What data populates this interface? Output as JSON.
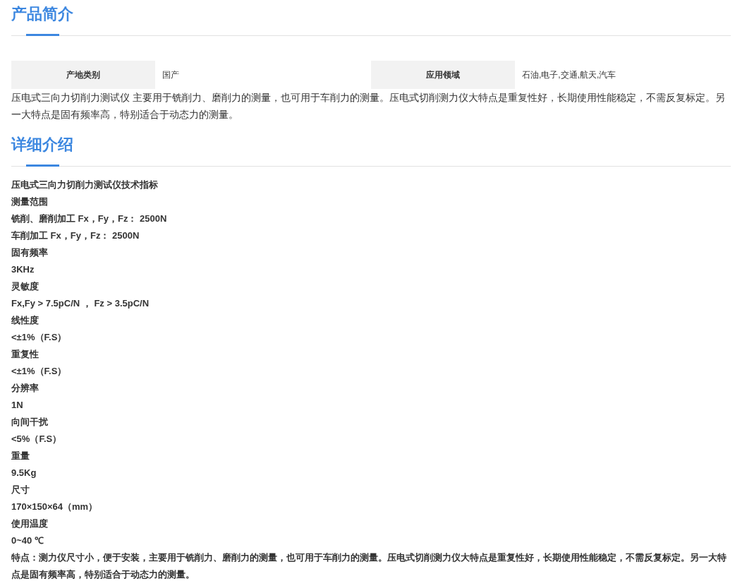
{
  "sections": [
    {
      "kind": "intro",
      "title": "产品简介",
      "attributes": [
        {
          "label": "产地类别",
          "value": "国产"
        },
        {
          "label": "应用领域",
          "value": "石油,电子,交通,航天,汽车"
        }
      ],
      "paragraph": "压电式三向力切削力测试仪 主要用于铣削力、磨削力的测量，也可用于车削力的测量。压电式切削测力仪大特点是重复性好，长期使用性能稳定，不需反复标定。另一大特点是固有频率高，特别适合于动态力的测量。"
    },
    {
      "kind": "detail",
      "title": "详细介绍",
      "lines": [
        "压电式三向力切削力测试仪技术指标",
        "测量范围",
        "铣削、磨削加工 Fx，Fy，Fz： 2500N",
        "车削加工 Fx，Fy，Fz： 2500N",
        "固有频率",
        "3KHz",
        "灵敏度",
        "Fx,Fy > 7.5pC/N ， Fz > 3.5pC/N",
        "线性度",
        "<±1%（F.S）",
        "重复性",
        "<±1%（F.S）",
        "分辨率",
        "1N",
        "向间干扰",
        "<5%（F.S）",
        "重量",
        "9.5Kg",
        "尺寸",
        "170×150×64（mm）",
        "使用温度",
        "0~40 ℃"
      ],
      "paragraph": "特点：测力仪尺寸小，便于安装，主要用于铣削力、磨削力的测量，也可用于车削力的测量。压电式切削测力仪大特点是重复性好，长期使用性能稳定，不需反复标定。另一大特点是固有频率高，特别适合于动态力的测量。"
    }
  ]
}
